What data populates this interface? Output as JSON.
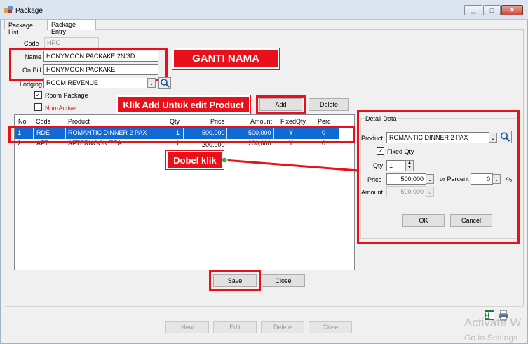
{
  "window": {
    "title": "Package"
  },
  "tabs": [
    "Package List",
    "Package Entry"
  ],
  "form": {
    "code_label": "Code",
    "code_value": "HPC",
    "name_label": "Name",
    "name_value": "HONYMOON PACKAKE  2N/3D",
    "onbill_label": "On Bill",
    "onbill_value": "HONYMOON PACKAKE",
    "lodging_label": "Lodging",
    "lodging_value": "ROOM REVENUE",
    "room_package_label": "Room Package",
    "non_active_label": "Non-Active"
  },
  "buttons": {
    "add": "Add",
    "delete": "Delete",
    "save": "Save",
    "close": "Close",
    "ok": "OK",
    "cancel": "Cancel",
    "new": "New",
    "edit": "Edit",
    "bottom_delete": "Delete",
    "bottom_close": "Close"
  },
  "grid": {
    "columns": [
      "No",
      "Code",
      "Product",
      "Qty",
      "Price",
      "Amount",
      "FixedQty",
      "Perc"
    ],
    "rows": [
      [
        "1",
        "RDE",
        "ROMANTIC DINNER 2 PAX",
        "1",
        "500,000",
        "500,000",
        "Y",
        "0"
      ],
      [
        "2",
        "AFT",
        "AFTERNOON TEA",
        "1",
        "200,000",
        "200,000",
        "Y",
        "0"
      ]
    ]
  },
  "detail": {
    "group_title": "Detail Data",
    "product_label": "Product",
    "product_value": "ROMANTIC DINNER 2 PAX",
    "fixed_qty_label": "Fixed Qty",
    "qty_label": "Qty",
    "qty_value": "1",
    "price_label": "Price",
    "price_value": "500,000",
    "or_percent_label": "or Percent",
    "percent_value": "0",
    "percent_unit": "%",
    "amount_label": "Amount",
    "amount_value": "500,000"
  },
  "annotations": {
    "ganti_nama": "GANTI NAMA",
    "klik_add": "Klik Add Untuk edit Product",
    "dobel_klik": "Dobel klik"
  },
  "watermark": {
    "line1": "Activate W",
    "line2": "Go to Settings"
  },
  "colors": {
    "annotation_red": "#e8101a",
    "selection_blue": "#0f6ad6",
    "connector_green": "#2fb02f"
  }
}
